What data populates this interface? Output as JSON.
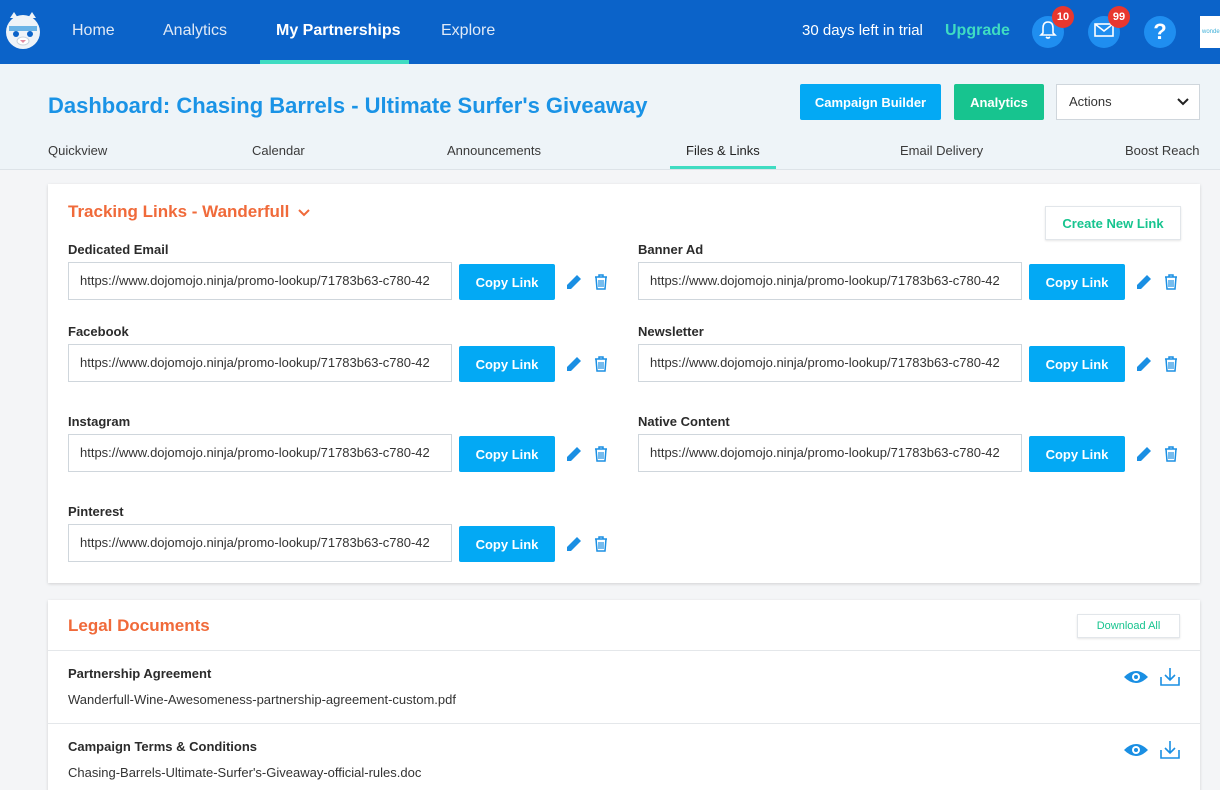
{
  "nav": {
    "items": [
      "Home",
      "Analytics",
      "My Partnerships",
      "Explore"
    ],
    "trial_text": "30 days left in trial",
    "upgrade_label": "Upgrade",
    "notifications_count": "10",
    "messages_count": "99",
    "help_glyph": "?",
    "brand_thumb": "wonde"
  },
  "header": {
    "title": "Dashboard: Chasing Barrels - Ultimate Surfer's Giveaway",
    "campaign_builder_label": "Campaign Builder",
    "analytics_label": "Analytics",
    "actions_label": "Actions",
    "tabs": [
      "Quickview",
      "Calendar",
      "Announcements",
      "Files & Links",
      "Email Delivery",
      "Boost Reach"
    ]
  },
  "tracking": {
    "title": "Tracking Links - Wanderfull",
    "create_label": "Create New Link",
    "copy_label": "Copy Link",
    "links": [
      {
        "label": "Dedicated Email",
        "url": "https://www.dojomojo.ninja/promo-lookup/71783b63-c780-42"
      },
      {
        "label": "Banner Ad",
        "url": "https://www.dojomojo.ninja/promo-lookup/71783b63-c780-42"
      },
      {
        "label": "Facebook",
        "url": "https://www.dojomojo.ninja/promo-lookup/71783b63-c780-42"
      },
      {
        "label": "Newsletter",
        "url": "https://www.dojomojo.ninja/promo-lookup/71783b63-c780-42"
      },
      {
        "label": "Instagram",
        "url": "https://www.dojomojo.ninja/promo-lookup/71783b63-c780-42"
      },
      {
        "label": "Native Content",
        "url": "https://www.dojomojo.ninja/promo-lookup/71783b63-c780-42"
      },
      {
        "label": "Pinterest",
        "url": "https://www.dojomojo.ninja/promo-lookup/71783b63-c780-42"
      }
    ]
  },
  "legal": {
    "title": "Legal Documents",
    "download_all_label": "Download All",
    "docs": [
      {
        "title": "Partnership Agreement",
        "file": "Wanderfull-Wine-Awesomeness-partnership-agreement-custom.pdf"
      },
      {
        "title": "Campaign Terms & Conditions",
        "file": "Chasing-Barrels-Ultimate-Surfer's-Giveaway-official-rules.doc"
      }
    ]
  },
  "colors": {
    "nav_bg": "#0b63c9",
    "accent_teal": "#3fdcc2",
    "primary_blue": "#03a9f4",
    "green": "#17c48f",
    "orange_title": "#f06a3a",
    "badge_red": "#e8372e"
  },
  "icons": [
    "tiger-logo-icon",
    "bell-icon",
    "mail-icon",
    "help-icon",
    "chevron-down-icon",
    "pencil-icon",
    "trash-icon",
    "eye-icon",
    "download-icon"
  ]
}
